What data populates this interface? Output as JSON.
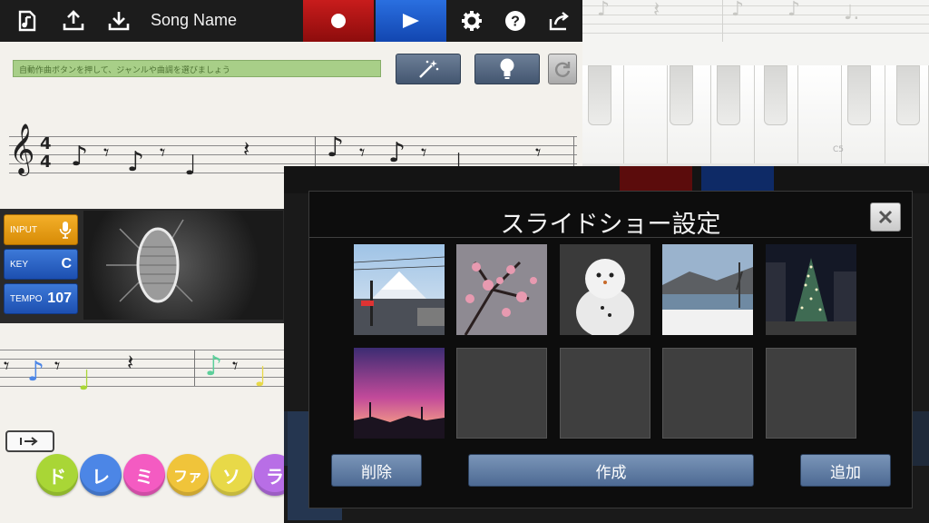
{
  "toolbar": {
    "song_name": "Song Name",
    "icons": [
      "document-music-icon",
      "upload-icon",
      "download-icon",
      "record-icon",
      "play-icon",
      "gear-icon",
      "help-icon",
      "share-icon"
    ]
  },
  "composer": {
    "hint_text": "自動作曲ボタンを押して、ジャンルや曲調を選びましょう",
    "tools": [
      "magic-wand-icon",
      "lightbulb-icon",
      "refresh-icon"
    ]
  },
  "params": {
    "input_label": "INPUT",
    "key_label": "KEY",
    "key_value": "C",
    "tempo_label": "TEMPO",
    "tempo_value": "107"
  },
  "piano": {
    "octave_label": "C5"
  },
  "solfege": {
    "keys": [
      {
        "label": "ド",
        "color": "#a9d636"
      },
      {
        "label": "レ",
        "color": "#4c86e6"
      },
      {
        "label": "ミ",
        "color": "#f45bc2"
      },
      {
        "label": "ファ",
        "color": "#f0c43a"
      },
      {
        "label": "ソ",
        "color": "#e8d948"
      },
      {
        "label": "ラ",
        "color": "#b86ee6"
      }
    ]
  },
  "dialog": {
    "title": "スライドショー設定",
    "photos": [
      "train-crossing-mount-fuji",
      "plum-blossoms",
      "snowman",
      "snowy-lakeside",
      "christmas-tree-night",
      "purple-sunset"
    ],
    "empty_slots": 4,
    "delete_label": "削除",
    "create_label": "作成",
    "add_label": "追加"
  },
  "colors": {
    "record": "#b01414",
    "play": "#1d56c8",
    "hint_bar": "#a8cf88",
    "dialog_button": "#5f7da5"
  }
}
